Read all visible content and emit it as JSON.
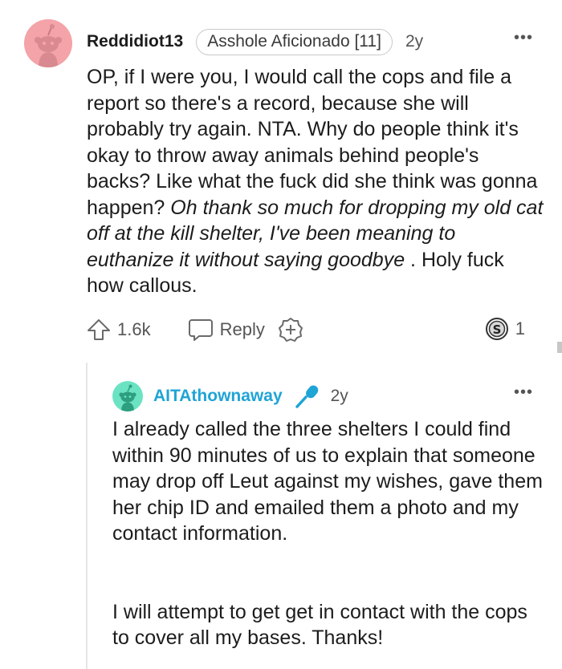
{
  "comment": {
    "username": "Reddidiot13",
    "flair": "Asshole Aficionado [11]",
    "age": "2y",
    "more": "•••",
    "body": {
      "part1": "OP, if I were you, I would call the cops and file a report so there's a record, because she will probably try again. NTA. Why do people think it's okay to throw away animals behind people's backs? Like what the fuck did she think was gonna happen? ",
      "italic": "Oh thank so much for dropping my old cat off at the kill shelter, I've been meaning to euthanize it without saying goodbye",
      "part2": " . Holy fuck how callous."
    },
    "actions": {
      "upvote_icon": "upvote-arrow-icon",
      "upvote_count": "1.6k",
      "reply_icon": "speech-bubble-icon",
      "reply_label": "Reply",
      "award_icon": "award-plus-icon",
      "award_badge_icon": "award-badge-icon",
      "award_count": "1"
    },
    "avatar_color": "#f4a3a8"
  },
  "reply": {
    "username": "AITAthownaway",
    "mic_icon": "microphone-icon",
    "age": "2y",
    "more": "•••",
    "paragraphs": [
      "I already called the three shelters I could find within 90 minutes of us to explain that someone may drop off Leut against my wishes, gave them her chip ID and emailed them a photo and my contact information.",
      "I will attempt to get get in contact with the cops to cover all my bases. Thanks!"
    ],
    "username_color": "#1fa4d6",
    "avatar_color": "#6be3c3"
  }
}
